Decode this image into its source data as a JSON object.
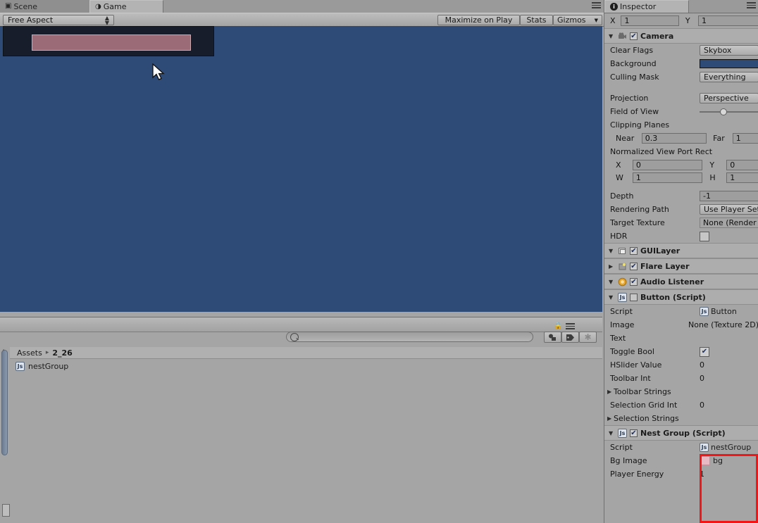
{
  "app": "Unity Editor",
  "tabs": {
    "scene": {
      "label": "Scene",
      "icon": "grid-icon"
    },
    "game": {
      "label": "Game",
      "icon": "gamepad-icon"
    },
    "inspector": {
      "label": "Inspector",
      "icon": "info-icon"
    }
  },
  "game_toolbar": {
    "aspect": "Free Aspect",
    "maximize_on_play": "Maximize on Play",
    "stats": "Stats",
    "gizmos": "Gizmos"
  },
  "game_view": {
    "background_color": "#2e4a77",
    "panel_color": "#171d2b",
    "bar_color": "#9c6b78",
    "cursor": "arrow-cursor"
  },
  "project": {
    "search_placeholder": "",
    "search_value": "",
    "breadcrumb": [
      "Assets",
      "2_26"
    ],
    "separator": "▸",
    "items": [
      {
        "label": "nestGroup",
        "icon": "js-script-icon"
      }
    ],
    "filters": [
      "animation-filter",
      "label-filter",
      "favorite-filter"
    ],
    "lock": "lock-icon",
    "menu": "menu-icon"
  },
  "inspector": {
    "header": {
      "title": "Inspector"
    },
    "position_row": {
      "x_label": "X",
      "x_value": "1",
      "y_label": "Y",
      "y_value": "1"
    },
    "components": [
      {
        "name": "Camera",
        "icon": "camera-icon",
        "enabled": true,
        "expanded": true,
        "properties": [
          {
            "label": "Clear Flags",
            "value": "Skybox",
            "kind": "popup"
          },
          {
            "label": "Background",
            "value": "",
            "kind": "color",
            "color": "#2e4a77"
          },
          {
            "label": "Culling Mask",
            "value": "Everything",
            "kind": "popup"
          },
          {
            "label": "Projection",
            "value": "Perspective",
            "kind": "popup"
          },
          {
            "label": "Field of View",
            "value": "",
            "kind": "slider"
          },
          {
            "label": "Clipping Planes",
            "value": "",
            "kind": "header"
          },
          {
            "label": "Near",
            "value": "0.3",
            "kind": "field2",
            "label2": "Far",
            "value2": "1"
          },
          {
            "label": "Normalized View Port Rect",
            "value": "",
            "kind": "header"
          },
          {
            "label": "X",
            "value": "0",
            "kind": "field2",
            "label2": "Y",
            "value2": "0"
          },
          {
            "label": "W",
            "value": "1",
            "kind": "field2",
            "label2": "H",
            "value2": "1"
          },
          {
            "label": "Depth",
            "value": "-1",
            "kind": "field"
          },
          {
            "label": "Rendering Path",
            "value": "Use Player Settings",
            "kind": "popup"
          },
          {
            "label": "Target Texture",
            "value": "None (Render Texture)",
            "kind": "object"
          },
          {
            "label": "HDR",
            "value": "",
            "kind": "checkbox",
            "checked": false
          }
        ]
      },
      {
        "name": "GUILayer",
        "icon": "guilayer-icon",
        "enabled": true,
        "expanded": true,
        "properties": []
      },
      {
        "name": "Flare Layer",
        "icon": "flare-icon",
        "enabled": true,
        "expanded": false,
        "properties": []
      },
      {
        "name": "Audio Listener",
        "icon": "audio-icon",
        "enabled": true,
        "expanded": true,
        "properties": []
      },
      {
        "name": "Button (Script)",
        "icon": "js-script-icon",
        "enabled": false,
        "expanded": true,
        "properties": [
          {
            "label": "Script",
            "value": "Button",
            "kind": "script-ref"
          },
          {
            "label": "Image",
            "value": "None (Texture 2D)",
            "kind": "object"
          },
          {
            "label": "Text",
            "value": "",
            "kind": "field"
          },
          {
            "label": "Toggle Bool",
            "value": "",
            "kind": "checkbox",
            "checked": true
          },
          {
            "label": "HSlider Value",
            "value": "0",
            "kind": "plain"
          },
          {
            "label": "Toolbar Int",
            "value": "0",
            "kind": "plain"
          },
          {
            "label": "Toolbar Strings",
            "value": "",
            "kind": "foldout"
          },
          {
            "label": "Selection Grid Int",
            "value": "0",
            "kind": "plain"
          },
          {
            "label": "Selection Strings",
            "value": "",
            "kind": "foldout"
          }
        ]
      },
      {
        "name": "Nest Group (Script)",
        "icon": "js-script-icon",
        "enabled": true,
        "expanded": true,
        "highlighted": true,
        "properties": [
          {
            "label": "Script",
            "value": "nestGroup",
            "kind": "script-ref"
          },
          {
            "label": "Bg Image",
            "value": "bg",
            "kind": "texture-ref"
          },
          {
            "label": "Player Energy",
            "value": "1",
            "kind": "plain"
          }
        ]
      }
    ]
  },
  "annotation": {
    "color": "#f71414",
    "target": "Nest Group (Script)"
  }
}
